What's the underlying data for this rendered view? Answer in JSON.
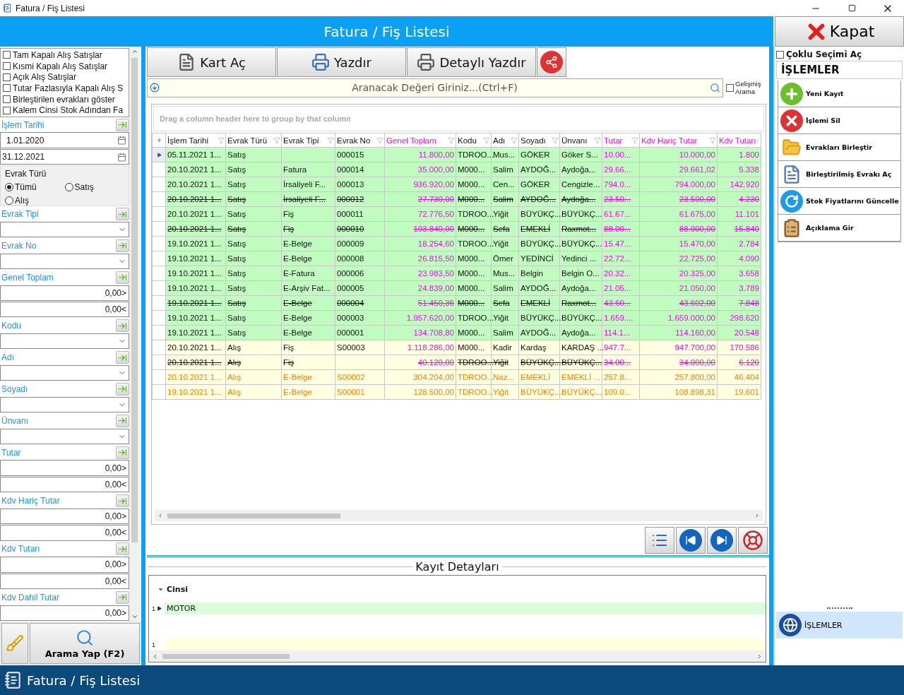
{
  "window": {
    "title": "Fatura / Fiş Listesi"
  },
  "header": {
    "title": "Fatura / Fiş Listesi",
    "close_button": "Kapat"
  },
  "filters": {
    "options": [
      {
        "label": "Tam Kapalı Alış Satışlar",
        "checked": false
      },
      {
        "label": "Kısmi Kapalı Alış Satışlar",
        "checked": false
      },
      {
        "label": "Açık Alış Satışlar",
        "checked": false
      },
      {
        "label": "Tutar Fazlasıyla Kapalı Alış S",
        "checked": false
      },
      {
        "label": "Birleştirilen evrakları göster",
        "checked": false
      },
      {
        "label": "Kalem Cinsi Stok Adından Fa",
        "checked": false
      }
    ],
    "fields": [
      {
        "kind": "date",
        "label": "İşlem Tarihi",
        "values": [
          "1.01.2020",
          "31.12.2021"
        ]
      },
      {
        "kind": "radio",
        "label": "Evrak Türü",
        "options": [
          {
            "label": "Tümü",
            "selected": true
          },
          {
            "label": "Satış",
            "selected": false
          },
          {
            "label": "Alış",
            "selected": false
          }
        ]
      },
      {
        "kind": "combo",
        "label": "Evrak Tipi"
      },
      {
        "kind": "combo",
        "label": "Evrak No"
      },
      {
        "kind": "range",
        "label": "Genel Toplam",
        "values": [
          "0,00>",
          "0,00<"
        ]
      },
      {
        "kind": "combo",
        "label": "Kodu"
      },
      {
        "kind": "combo",
        "label": "Adı"
      },
      {
        "kind": "combo",
        "label": "Soyadı"
      },
      {
        "kind": "combo",
        "label": "Ünvanı"
      },
      {
        "kind": "range",
        "label": "Tutar",
        "values": [
          "0,00>",
          "0,00<"
        ]
      },
      {
        "kind": "range",
        "label": "Kdv Hariç Tutar",
        "values": [
          "0,00>",
          "0,00<"
        ]
      },
      {
        "kind": "range",
        "label": "Kdv Tutarı",
        "values": [
          "0,00>",
          "0,00<"
        ]
      },
      {
        "kind": "range",
        "label": "Kdv Dahil Tutar",
        "values": [
          "0,00>"
        ]
      }
    ],
    "search_button": "Arama Yap (F2)"
  },
  "toolbar": [
    "Kart Aç",
    "Yazdır",
    "Detaylı Yazdır"
  ],
  "search": {
    "placeholder": "Aranacak Değeri Giriniz...(Ctrl+F)",
    "advanced": {
      "label": "Gelişmiş Arama",
      "checked": false
    }
  },
  "grid": {
    "group_hint": "Drag a column header here to group by that column",
    "columns": [
      {
        "label": "İşlem Tarihi",
        "kind": "text"
      },
      {
        "label": "Evrak Türü",
        "kind": "text"
      },
      {
        "label": "Evrak Tipi",
        "kind": "text"
      },
      {
        "label": "Evrak No",
        "kind": "text"
      },
      {
        "label": "Genel Toplam",
        "kind": "amount"
      },
      {
        "label": "Kodu",
        "kind": "text"
      },
      {
        "label": "Adı",
        "kind": "text"
      },
      {
        "label": "Soyadı",
        "kind": "text"
      },
      {
        "label": "Ünvanı",
        "kind": "text"
      },
      {
        "label": "Tutar",
        "kind": "amount_short"
      },
      {
        "label": "Kdv Hariç Tutar",
        "kind": "amount"
      },
      {
        "label": "Kdv Tutarı",
        "kind": "amount"
      }
    ],
    "rows": [
      {
        "kind": "sale",
        "cancelled": false,
        "pending": false,
        "selected": true,
        "cells": [
          "05.11.2021 1...",
          "Satış",
          null,
          "000015",
          "11.800,00",
          "TDROO...",
          "Mus...",
          "GÖKER",
          "Göker S...",
          "10.00...",
          "10.000,00",
          "1.800"
        ]
      },
      {
        "kind": "sale",
        "cancelled": false,
        "pending": false,
        "selected": false,
        "cells": [
          "20.10.2021 1...",
          "Satış",
          "Fatura",
          "000014",
          "35.000,00",
          "M000...",
          "Salim",
          "AYDOĞ...",
          "Aydoğa...",
          "29.66...",
          "29.661,02",
          "5.338"
        ]
      },
      {
        "kind": "sale",
        "cancelled": false,
        "pending": false,
        "selected": false,
        "cells": [
          "20.10.2021 1...",
          "Satış",
          "İrsaliyeli F...",
          "000013",
          "936.920,00",
          "M000...",
          "Cen...",
          "GÖKER",
          "Cengizle...",
          "794.0...",
          "794.000,00",
          "142.920"
        ]
      },
      {
        "kind": "sale",
        "cancelled": true,
        "pending": false,
        "selected": false,
        "cells": [
          "20.10.2021 1...",
          "Satış",
          "İrsaliyeli F...",
          "000012",
          "27.730,00",
          "M000...",
          "Salim",
          "AYDOĞ...",
          "Aydoğa...",
          "23.50...",
          "23.500,00",
          "4.230"
        ]
      },
      {
        "kind": "sale",
        "cancelled": false,
        "pending": false,
        "selected": false,
        "cells": [
          "20.10.2021 1...",
          "Satış",
          "Fiş",
          "000011",
          "72.776,50",
          "TDROO...",
          "Yiğit",
          "BÜYÜKÇ...",
          "BÜYÜKÇ...",
          "61.67...",
          "61.675,00",
          "11.101"
        ]
      },
      {
        "kind": "sale",
        "cancelled": true,
        "pending": false,
        "selected": false,
        "cells": [
          "20.10.2021 1...",
          "Satış",
          "Fiş",
          "000010",
          "103.840,00",
          "M000...",
          "Sefa",
          "EMEKLİ",
          "Raxmot...",
          "88.00...",
          "88.000,00",
          "15.840"
        ]
      },
      {
        "kind": "sale",
        "cancelled": false,
        "pending": false,
        "selected": false,
        "cells": [
          "19.10.2021 1...",
          "Satış",
          "E-Belge",
          "000009",
          "18.254,60",
          "TDROO...",
          "Yiğit",
          "BÜYÜKÇ...",
          "BÜYÜKÇ...",
          "15.47...",
          "15.470,00",
          "2.784"
        ]
      },
      {
        "kind": "sale",
        "cancelled": false,
        "pending": false,
        "selected": false,
        "cells": [
          "19.10.2021 1...",
          "Satış",
          "E-Belge",
          "000008",
          "26.815,50",
          "M000...",
          "Ömer",
          "YEDİNCİ",
          "Yedinci ...",
          "22.72...",
          "22.725,00",
          "4.090"
        ]
      },
      {
        "kind": "sale",
        "cancelled": false,
        "pending": false,
        "selected": false,
        "cells": [
          "19.10.2021 1...",
          "Satış",
          "E-Fatura",
          "000006",
          "23.983,50",
          "M000...",
          "Mus...",
          "Belgin",
          "Belgin O...",
          "20.32...",
          "20.325,00",
          "3.658"
        ]
      },
      {
        "kind": "sale",
        "cancelled": false,
        "pending": false,
        "selected": false,
        "cells": [
          "19.10.2021 1...",
          "Satış",
          "E-Arşiv Fat...",
          "000005",
          "24.839,00",
          "M000...",
          "Salim",
          "AYDOĞ...",
          "Aydoğa...",
          "21.05...",
          "21.050,00",
          "3.789"
        ]
      },
      {
        "kind": "sale",
        "cancelled": true,
        "pending": false,
        "selected": false,
        "cells": [
          "19.10.2021 1...",
          "Satış",
          "E-Belge",
          "000004",
          "51.450,36",
          "M000...",
          "Sefa",
          "EMEKLİ",
          "Raxmot...",
          "43.60...",
          "43.602,00",
          "7.848"
        ]
      },
      {
        "kind": "sale",
        "cancelled": false,
        "pending": false,
        "selected": false,
        "cells": [
          "19.10.2021 1...",
          "Satış",
          "E-Belge",
          "000003",
          "1.957.620,00",
          "TDROO...",
          "Yiğit",
          "BÜYÜKÇ...",
          "BÜYÜKÇ...",
          "1.659....",
          "1.659.000,00",
          "298.620"
        ]
      },
      {
        "kind": "sale",
        "cancelled": false,
        "pending": false,
        "selected": false,
        "cells": [
          "19.10.2021 1...",
          "Satış",
          "E-Belge",
          "000001",
          "134.708,80",
          "M000...",
          "Salim",
          "AYDOĞ...",
          "Aydoğa...",
          "114.1...",
          "114.160,00",
          "20.548"
        ]
      },
      {
        "kind": "purchase",
        "cancelled": false,
        "pending": false,
        "selected": false,
        "cells": [
          "20.10.2021 1...",
          "Alış",
          "Fiş",
          "S00003",
          "1.118.286,00",
          "M000...",
          "Kadir",
          "Kardaş",
          "KARDAŞ ...",
          "947.7...",
          "947.700,00",
          "170.586"
        ]
      },
      {
        "kind": "purchase",
        "cancelled": true,
        "pending": false,
        "selected": false,
        "cells": [
          "20.10.2021 1...",
          "Alış",
          "Fiş",
          null,
          "40.120,00",
          "TDROO...",
          "Yiğit",
          "BÜYÜKÇ...",
          "BÜYÜKÇ...",
          "34.00...",
          "34.000,00",
          "6.120"
        ]
      },
      {
        "kind": "purchase",
        "cancelled": false,
        "pending": true,
        "selected": false,
        "cells": [
          "20.10.2021 1...",
          "Alış",
          "E-Belge",
          "S00002",
          "304.204,00",
          "TDROO...",
          "Naz...",
          "EMEKLİ",
          "EMEKLİ ...",
          "257.8...",
          "257.800,00",
          "46.404"
        ]
      },
      {
        "kind": "purchase",
        "cancelled": false,
        "pending": true,
        "selected": false,
        "cells": [
          "19.10.2021 1...",
          "Alış",
          "E-Belge",
          "S00001",
          "128.500,00",
          "TDROO...",
          "Yiğit",
          "BÜYÜKÇ...",
          "BÜYÜKÇ...",
          "109.0...",
          "108.898,31",
          "19.601"
        ]
      }
    ]
  },
  "details": {
    "title": "Kayıt Detayları",
    "column": "Cinsi",
    "rows": [
      {
        "number": "1",
        "value": "MOTOR",
        "selected": true
      }
    ],
    "new_row_number": "1"
  },
  "actions": {
    "multi_select": {
      "label": "Çoklu Seçimi Aç",
      "checked": false
    },
    "title": "İŞLEMLER",
    "items": [
      "Yeni Kayıt",
      "İşlemi Sil",
      "Evrakları Birleştir",
      "Birleştirilmiş Evrakı Aç",
      "Stok Fiyatlarını Güncelle",
      "Açıklama Gir"
    ],
    "footer": "İŞLEMLER"
  },
  "status_bar": {
    "title": "Fatura / Fiş Listesi"
  }
}
